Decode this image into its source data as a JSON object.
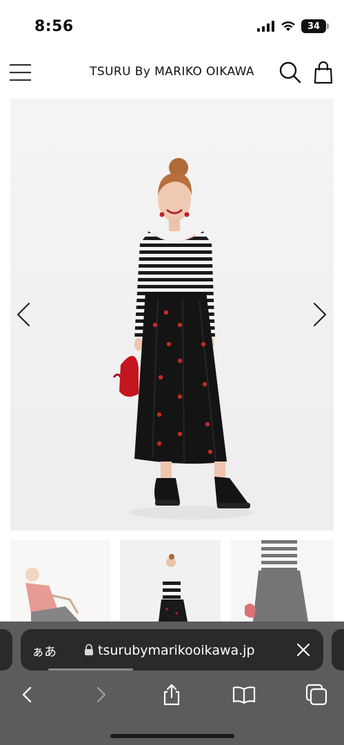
{
  "status_bar": {
    "time": "8:56",
    "battery": "34"
  },
  "header": {
    "brand": "TSURU By MARIKO OIKAWA"
  },
  "product": {
    "gallery_count": 3
  },
  "browser": {
    "aa_label": "ぁあ",
    "url": "tsurubymarikooikawa.jp",
    "load_progress": 0.28
  },
  "colors": {
    "safari_bar": "#5c5c5c",
    "url_pill": "#2a2a2a",
    "text_dark": "#111111",
    "skirt": "#141414",
    "flower": "#c42a24",
    "bag": "#c4161f"
  }
}
